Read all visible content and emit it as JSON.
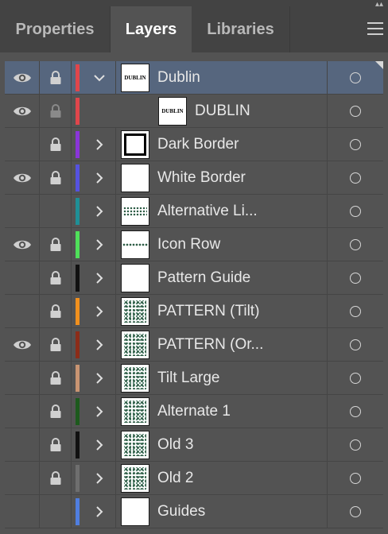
{
  "tabs": [
    {
      "label": "Properties",
      "active": false
    },
    {
      "label": "Layers",
      "active": true
    },
    {
      "label": "Libraries",
      "active": false
    }
  ],
  "layers": [
    {
      "name": "Dublin",
      "color": "#e0464b",
      "visible": true,
      "locked": true,
      "expanded": true,
      "selected": true,
      "thumb": "dublin-text"
    },
    {
      "name": "DUBLIN",
      "color": "#e0464b",
      "visible": true,
      "locked": true,
      "sublayer": true,
      "thumb": "dublin-text"
    },
    {
      "name": "Dark Border",
      "color": "#8a35d8",
      "visible": false,
      "locked": true,
      "thumb": "border"
    },
    {
      "name": "White Border",
      "color": "#5552e0",
      "visible": true,
      "locked": true,
      "thumb": "blank"
    },
    {
      "name": "Alternative Li...",
      "color": "#1f8f96",
      "visible": false,
      "locked": false,
      "thumb": "alt-line"
    },
    {
      "name": "Icon Row",
      "color": "#4fe05a",
      "visible": true,
      "locked": true,
      "thumb": "icon-row"
    },
    {
      "name": "Pattern Guide",
      "color": "#111111",
      "visible": false,
      "locked": true,
      "thumb": "blank"
    },
    {
      "name": "PATTERN (Tilt)",
      "color": "#f0901e",
      "visible": false,
      "locked": true,
      "thumb": "pattern"
    },
    {
      "name": "PATTERN (Or...",
      "color": "#8c2c18",
      "visible": true,
      "locked": true,
      "thumb": "pattern"
    },
    {
      "name": "Tilt Large",
      "color": "#c89472",
      "visible": false,
      "locked": true,
      "thumb": "pattern"
    },
    {
      "name": "Alternate 1",
      "color": "#1d5a1d",
      "visible": false,
      "locked": true,
      "thumb": "pattern"
    },
    {
      "name": "Old 3",
      "color": "#111111",
      "visible": false,
      "locked": true,
      "thumb": "pattern"
    },
    {
      "name": "Old 2",
      "color": "#6e6e6e",
      "visible": false,
      "locked": true,
      "thumb": "pattern"
    },
    {
      "name": "Guides",
      "color": "#4f7ee0",
      "visible": false,
      "locked": false,
      "thumb": "blank"
    }
  ],
  "thumb_labels": {
    "dublin": "DUBLIN"
  },
  "icons": {
    "visibility": "eye-icon",
    "lock": "lock-icon",
    "expand": "chevron-right-icon",
    "collapse": "chevron-down-icon",
    "target": "target-circle-icon",
    "menu": "hamburger-menu-icon"
  }
}
